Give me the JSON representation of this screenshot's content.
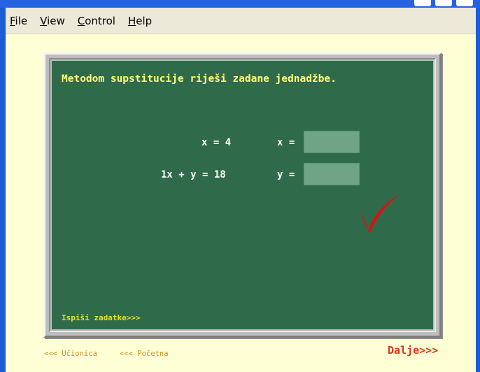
{
  "menu": {
    "file": {
      "mnemonic": "F",
      "rest": "ile"
    },
    "view": {
      "mnemonic": "V",
      "rest": "iew"
    },
    "control": {
      "mnemonic": "C",
      "rest": "ontrol"
    },
    "help": {
      "mnemonic": "H",
      "rest": "elp"
    }
  },
  "board": {
    "instruction": "Metodom supstitucije riješi zadane jednadžbe.",
    "equation1": "x = 4",
    "equation2": "1x + y = 18",
    "x_label": "x =",
    "y_label": "y =",
    "x_value": "",
    "y_value": "",
    "print_link": "Ispiši zadatke>>>"
  },
  "footer": {
    "classroom_link": "<<< Učionica",
    "home_link": "<<< Početna",
    "next_link": "Dalje>>>"
  },
  "colors": {
    "window_blue": "#1c5bd6",
    "content_bg": "#ffffd6",
    "board_green": "#2f6b4b",
    "instruction_yellow": "#fffc7a",
    "checkmark_red": "#e01010",
    "next_red": "#d63a1a"
  },
  "icons": {
    "result": "checkmark-icon"
  }
}
